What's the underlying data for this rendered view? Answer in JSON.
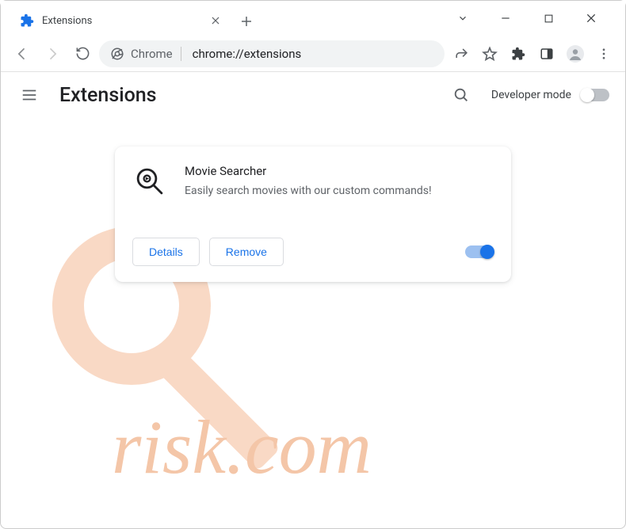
{
  "tab": {
    "title": "Extensions"
  },
  "omnibox": {
    "label": "Chrome",
    "url": "chrome://extensions"
  },
  "page_header": {
    "title": "Extensions",
    "dev_mode_label": "Developer mode"
  },
  "extension": {
    "name": "Movie Searcher",
    "description": "Easily search movies with our custom commands!",
    "details_label": "Details",
    "remove_label": "Remove"
  },
  "watermark": {
    "text": "risk.com"
  }
}
